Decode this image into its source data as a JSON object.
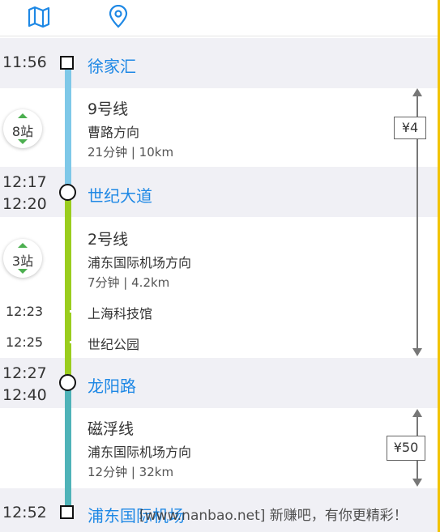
{
  "toolbar": {
    "left_icon": "map-book-icon",
    "right_icon": "location-pin-icon",
    "accent": "#1e88e5"
  },
  "colors": {
    "line9": "#7ec8e8",
    "line2": "#9acd1e",
    "maglev": "#4fb3b8",
    "station_text": "#1e88e5",
    "band": "#f0f0f5"
  },
  "route": {
    "stops": [
      {
        "time": "11:56",
        "name": "徐家汇"
      },
      {
        "arrive": "12:17",
        "depart": "12:20",
        "name": "世纪大道"
      },
      {
        "arrive": "12:27",
        "depart": "12:40",
        "name": "龙阳路"
      },
      {
        "time": "12:52",
        "name": "浦东国际机场"
      }
    ],
    "legs": [
      {
        "line": "9号线",
        "direction": "曹路方向",
        "stats": "21分钟 | 10km",
        "stations": "8站"
      },
      {
        "line": "2号线",
        "direction": "浦东国际机场方向",
        "stats": "7分钟 | 4.2km",
        "stations": "3站",
        "intermediate": [
          {
            "time": "12:23",
            "name": "上海科技馆"
          },
          {
            "time": "12:25",
            "name": "世纪公园"
          }
        ]
      },
      {
        "line": "磁浮线",
        "direction": "浦东国际机场方向",
        "stats": "12分钟 | 32km"
      }
    ],
    "fares": [
      "¥4",
      "¥50"
    ]
  },
  "watermark": "[www.nanbao.net] 新赚吧，有你更精彩！"
}
